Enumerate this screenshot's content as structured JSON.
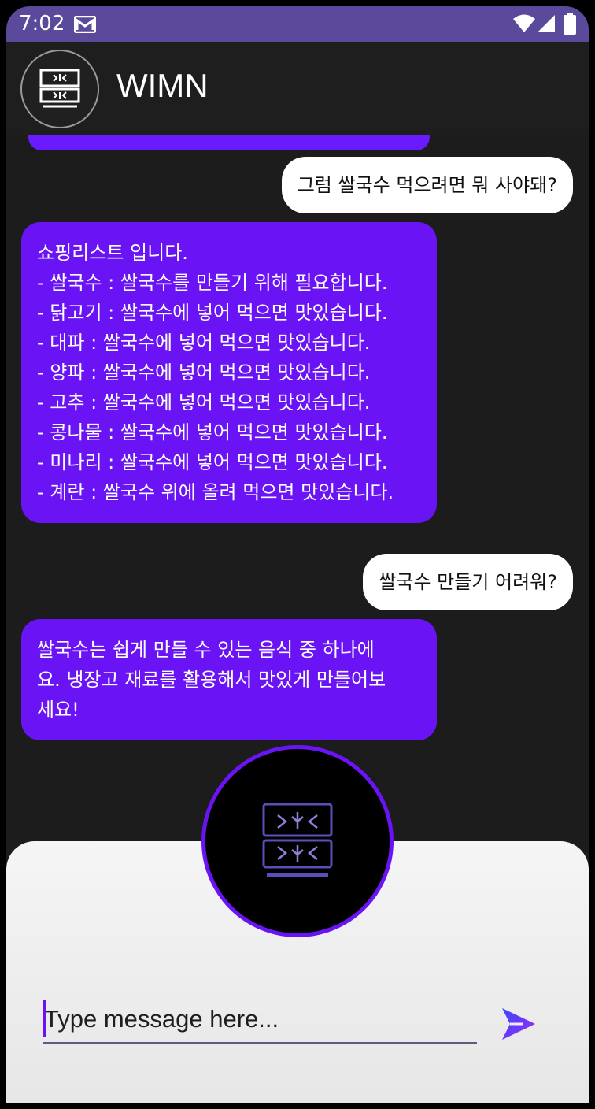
{
  "status_bar": {
    "time": "7:02"
  },
  "header": {
    "title": "WIMN"
  },
  "messages": [
    {
      "role": "user",
      "text": "그럼 쌀국수 먹으려면 뭐 사야돼?"
    },
    {
      "role": "bot",
      "lines": [
        "쇼핑리스트 입니다.",
        "",
        "- 쌀국수 : 쌀국수를 만들기 위해 필요합니다.",
        "- 닭고기 : 쌀국수에 넣어 먹으면 맛있습니다.",
        "- 대파 : 쌀국수에 넣어 먹으면 맛있습니다.",
        "- 양파 : 쌀국수에 넣어 먹으면 맛있습니다.",
        "- 고추 : 쌀국수에 넣어 먹으면 맛있습니다.",
        "- 콩나물 : 쌀국수에 넣어 먹으면 맛있습니다.",
        "- 미나리 : 쌀국수에 넣어 먹으면 맛있습니다.",
        "- 계란 : 쌀국수 위에 올려 먹으면 맛있습니다."
      ]
    },
    {
      "role": "user",
      "text": "쌀국수 만들기 어려워?"
    },
    {
      "role": "bot",
      "lines": [
        "쌀국수는 쉽게 만들 수 있는 음식 중 하나에",
        "요. 냉장고 재료를 활용해서 맛있게 만들어보",
        "세요!"
      ]
    }
  ],
  "input": {
    "placeholder": "Type message here..."
  },
  "icons": {
    "status": [
      "gmail-icon",
      "wifi-icon",
      "signal-icon",
      "battery-icon"
    ],
    "avatar": "fridge-icon",
    "send": "send-icon"
  },
  "colors": {
    "status_bar": "#5b4a9c",
    "bot_bubble": "#6a14f5",
    "user_bubble": "#ffffff",
    "background": "#1c1c1c"
  }
}
